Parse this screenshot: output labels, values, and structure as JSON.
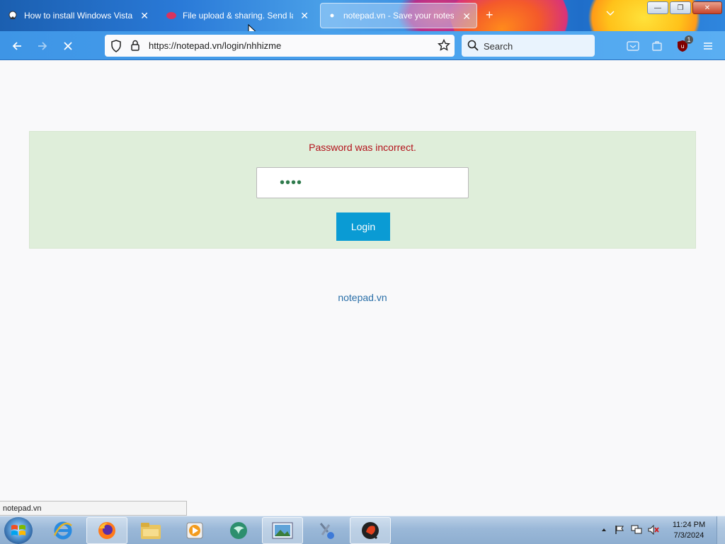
{
  "browser": {
    "tabs": [
      {
        "title": "How to install Windows Vista m",
        "icon": "page-icon",
        "active": false
      },
      {
        "title": "File upload & sharing. Send larg",
        "icon": "upload-icon",
        "active": false
      },
      {
        "title": "notepad.vn - Save your notes",
        "icon": "loading-dot-icon",
        "active": true
      }
    ],
    "new_tab": "+",
    "tab_close": "✕",
    "window_controls": {
      "minimize": "—",
      "maximize": "❐",
      "close": "✕"
    },
    "url": "https://notepad.vn/login/nhhizme",
    "search_placeholder": "Search",
    "extension_badge": "1",
    "status_url": "notepad.vn"
  },
  "page": {
    "error_message": "Password was incorrect.",
    "password_value": "••••",
    "login_label": "Login",
    "footer_link": "notepad.vn"
  },
  "taskbar": {
    "time": "11:24 PM",
    "date": "7/3/2024",
    "apps": [
      "ie-icon",
      "firefox-icon",
      "file-explorer-icon",
      "media-player-icon",
      "app-bubble-icon",
      "image-viewer-icon",
      "tools-icon",
      "q-app-icon"
    ]
  },
  "colors": {
    "error": "#b3121b",
    "panel": "#dfeeda",
    "button": "#0a9bd4",
    "link": "#2a6fa8"
  }
}
